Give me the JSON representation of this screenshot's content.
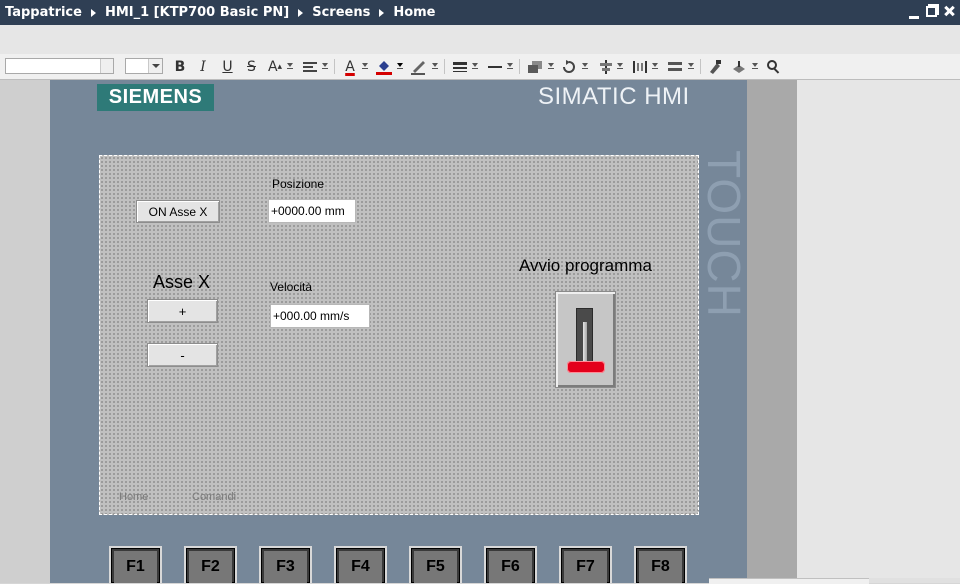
{
  "breadcrumb": [
    "Tappatrice",
    "HMI_1 [KTP700 Basic PN]",
    "Screens",
    "Home"
  ],
  "toolbar": {
    "font_name": "",
    "font_size": "",
    "bold": "B",
    "italic": "I",
    "underline": "U",
    "strikethrough": "S",
    "grow_font": "A",
    "font_color": "A",
    "colors": {
      "font_color_bar": "#d40000",
      "fill_color_bar": "#d40000"
    }
  },
  "device": {
    "brand": "SIEMENS",
    "model_label": "SIMATIC HMI",
    "side_label": "TOUCH",
    "function_keys": [
      "F1",
      "F2",
      "F3",
      "F4",
      "F5",
      "F6",
      "F7",
      "F8"
    ],
    "colors": {
      "bezel": "#768799",
      "logo_bg": "#2e7a78"
    }
  },
  "screen": {
    "on_axis_button": "ON Asse X",
    "position_label": "Posizione",
    "position_value": "+0000.00 mm",
    "axis_title": "Asse X",
    "plus_button": "+",
    "minus_button": "-",
    "speed_label": "Velocità",
    "speed_value": "+000.00 mm/s",
    "program_label": "Avvio programma",
    "program_switch_state": "off",
    "tabs": [
      "Home",
      "Comandi"
    ]
  }
}
